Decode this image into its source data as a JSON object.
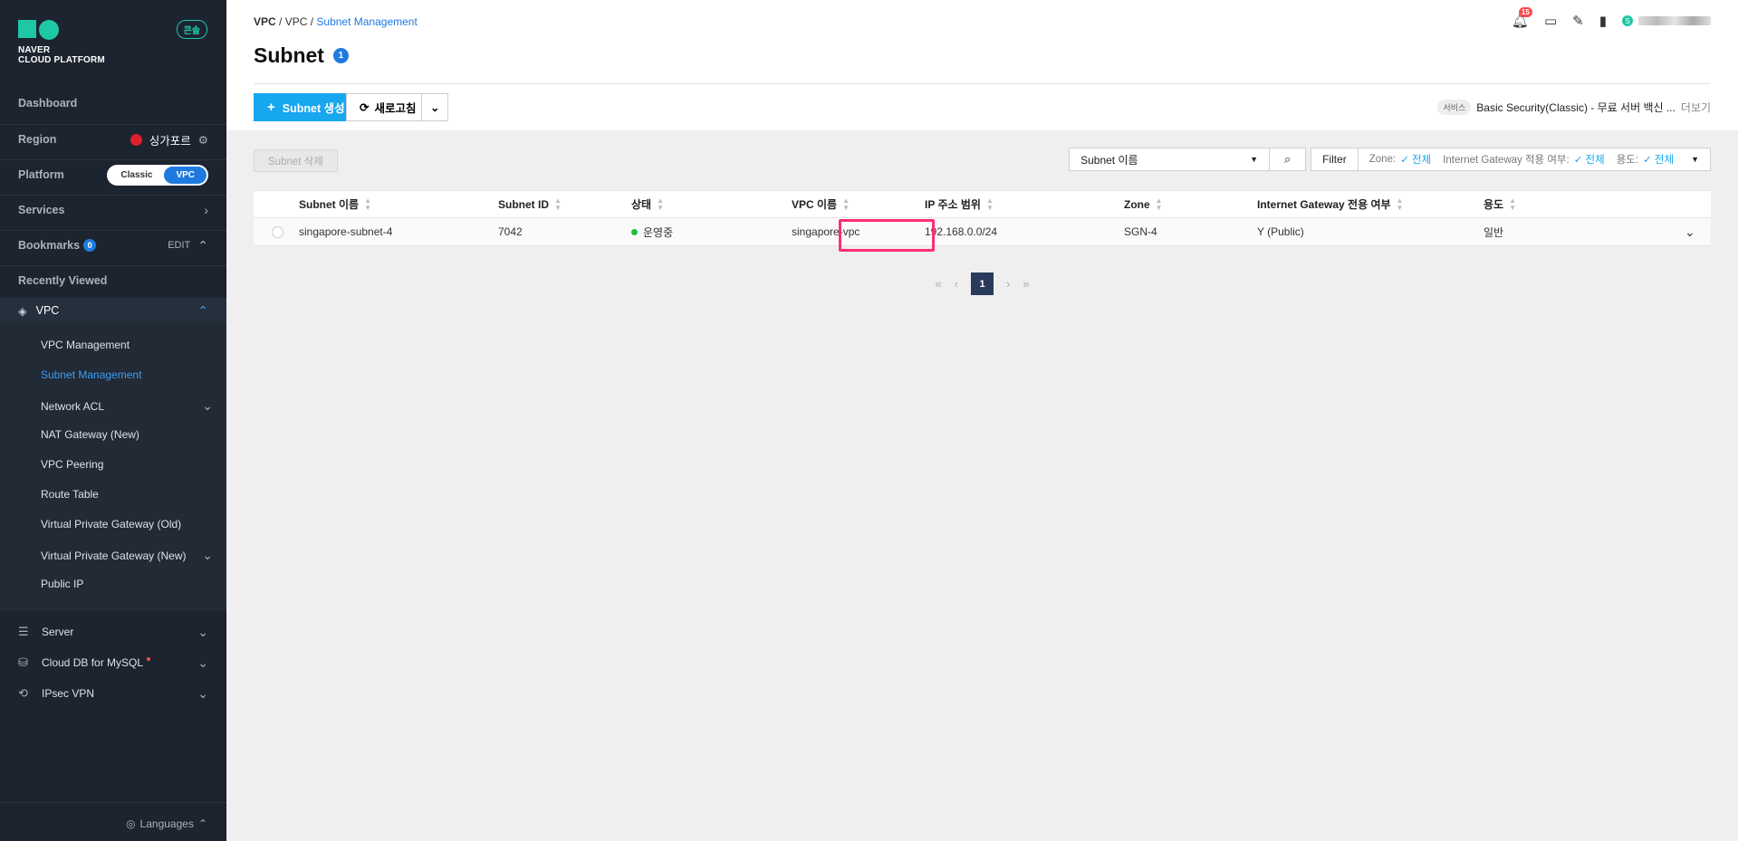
{
  "sidebar": {
    "logo_line1": "NAVER",
    "logo_line2": "CLOUD PLATFORM",
    "console_badge": "콘솔",
    "dashboard": "Dashboard",
    "region_label": "Region",
    "region_value": "싱가포르",
    "platform_label": "Platform",
    "platform_classic": "Classic",
    "platform_vpc": "VPC",
    "services": "Services",
    "bookmarks": "Bookmarks",
    "bookmarks_count": "0",
    "edit": "EDIT",
    "recently_viewed": "Recently Viewed",
    "vpc": "VPC",
    "vpc_items": [
      "VPC Management",
      "Subnet Management",
      "Network ACL",
      "NAT Gateway (New)",
      "VPC Peering",
      "Route Table",
      "Virtual Private Gateway (Old)",
      "Virtual Private Gateway (New)",
      "Public IP"
    ],
    "services_list": [
      "Server",
      "Cloud DB for MySQL",
      "IPsec VPN"
    ],
    "languages": "Languages"
  },
  "header": {
    "breadcrumb": [
      "VPC",
      "VPC",
      "Subnet Management"
    ],
    "title": "Subnet",
    "title_count": "1",
    "notification_count": "15",
    "avatar_letter": "S"
  },
  "toolbar": {
    "create_label": "Subnet 생성",
    "refresh_label": "새로고침",
    "service_tag": "서비스",
    "service_text": "Basic Security(Classic) - 무료 서버 백신 ...",
    "service_more": "더보기"
  },
  "filters": {
    "delete_label": "Subnet 삭제",
    "select_value": "Subnet 이름",
    "filter_label": "Filter",
    "zone_label": "Zone:",
    "zone_value": "전체",
    "igw_label": "Internet Gateway 적용 여부:",
    "igw_value": "전체",
    "usage_label": "용도:",
    "usage_value": "전체"
  },
  "table": {
    "columns": [
      "Subnet 이름",
      "Subnet ID",
      "상태",
      "VPC 이름",
      "IP 주소 범위",
      "Zone",
      "Internet Gateway 전용 여부",
      "용도"
    ],
    "rows": [
      {
        "name": "singapore-subnet-4",
        "id": "7042",
        "status": "운영중",
        "vpc": "singapore-vpc",
        "ip": "192.168.0.0/24",
        "zone": "SGN-4",
        "igw": "Y (Public)",
        "usage": "일반"
      }
    ]
  },
  "pagination": {
    "current": "1"
  },
  "colors": {
    "accent": "#17a7ef",
    "sidebar_bg": "#1c2430",
    "highlight": "#ff2e74",
    "status_ok": "#1fbf42"
  }
}
